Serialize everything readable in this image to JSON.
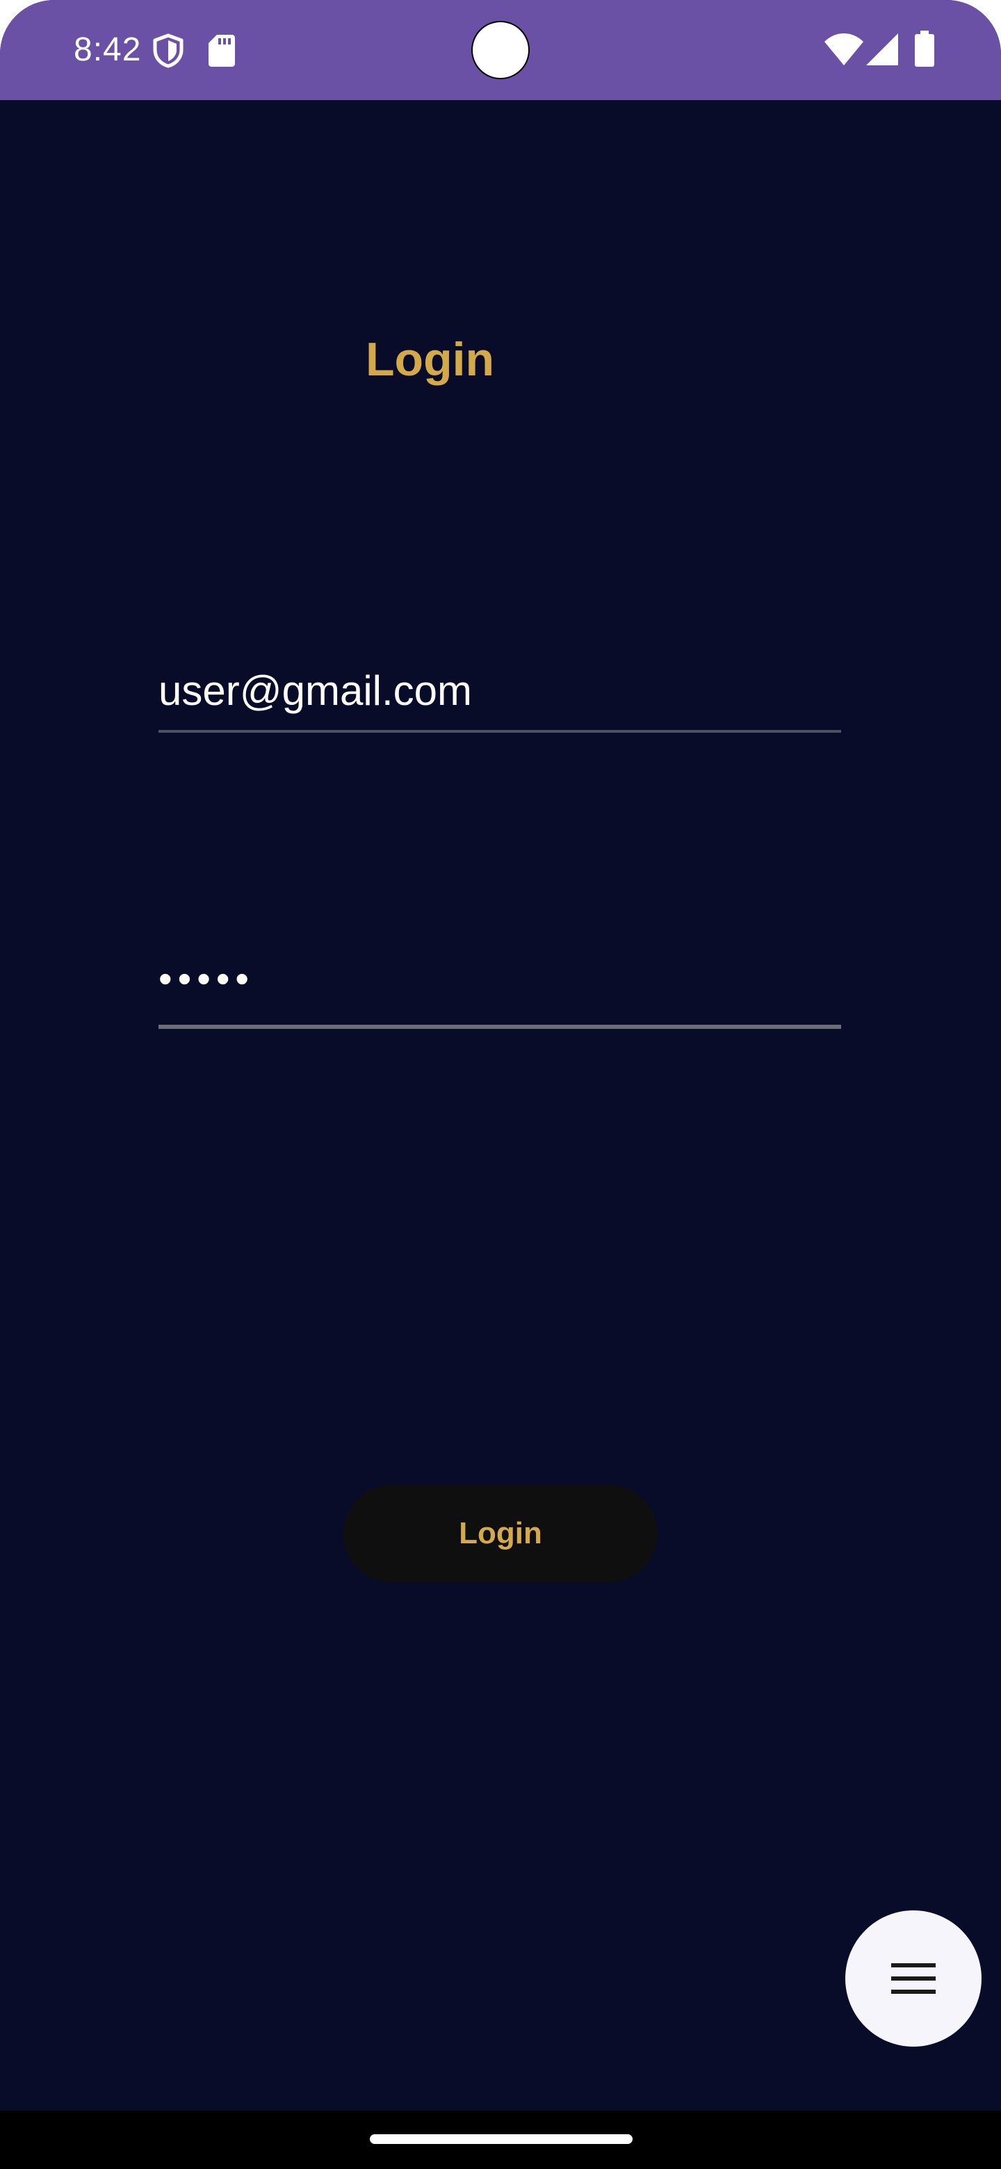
{
  "status_bar": {
    "time": "8:42",
    "icons": [
      "shield-icon",
      "sd-card-icon",
      "wifi-icon",
      "cellular-signal-icon",
      "battery-icon"
    ],
    "background": "#6a51a6"
  },
  "screen": {
    "title": "Login",
    "email_field": {
      "value": "user@gmail.com"
    },
    "password_field": {
      "value": "•••••"
    },
    "login_button": {
      "label": "Login"
    },
    "fab": {
      "icon": "menu-icon"
    }
  },
  "colors": {
    "background": "#080c29",
    "accent": "#d4a94a",
    "button_background": "#0f0f0f",
    "fab_background": "#f6f5fc"
  }
}
